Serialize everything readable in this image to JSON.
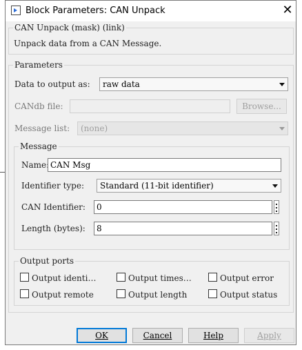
{
  "window": {
    "title": "Block Parameters: CAN Unpack",
    "close_icon": "close-icon"
  },
  "mask": {
    "legend": "CAN Unpack (mask) (link)",
    "description": "Unpack data from a CAN Message."
  },
  "parameters": {
    "legend": "Parameters",
    "data_output_label": "Data to output as:",
    "data_output_value": "raw data",
    "candb_label": "CANdb file:",
    "candb_value": "",
    "browse_label": "Browse...",
    "message_list_label": "Message list:",
    "message_list_value": "(none)"
  },
  "message": {
    "legend": "Message",
    "name_label": "Name:",
    "name_value": "CAN Msg",
    "identifier_type_label": "Identifier type:",
    "identifier_type_value": "Standard (11-bit identifier)",
    "can_identifier_label": "CAN Identifier:",
    "can_identifier_value": "0",
    "length_label": "Length (bytes):",
    "length_value": "8"
  },
  "output_ports": {
    "legend": "Output ports",
    "items": [
      {
        "label": "Output identi…",
        "checked": false
      },
      {
        "label": "Output times…",
        "checked": false
      },
      {
        "label": "Output error",
        "checked": false
      },
      {
        "label": "Output remote",
        "checked": false
      },
      {
        "label": "Output length",
        "checked": false
      },
      {
        "label": "Output status",
        "checked": false
      }
    ]
  },
  "buttons": {
    "ok": "OK",
    "cancel": "Cancel",
    "help": "Help",
    "apply": "Apply"
  }
}
